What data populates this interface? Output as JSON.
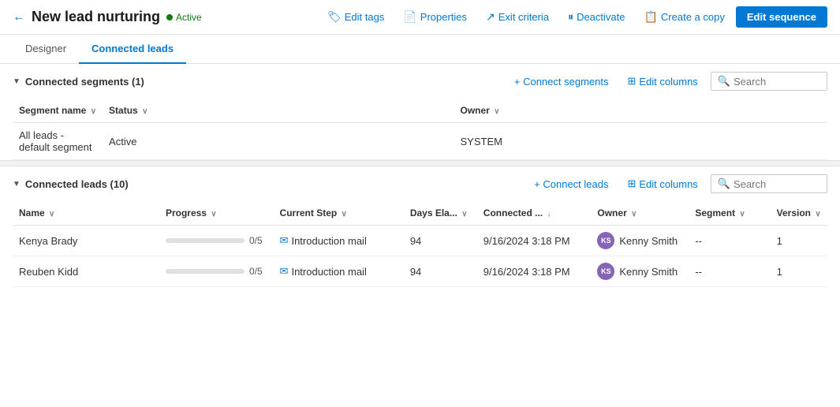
{
  "header": {
    "back_label": "←",
    "title": "New lead nurturing",
    "status": "Active",
    "actions": [
      {
        "label": "Edit tags",
        "icon": "🏷"
      },
      {
        "label": "Properties",
        "icon": "📄"
      },
      {
        "label": "Exit criteria",
        "icon": "↗"
      },
      {
        "label": "Deactivate",
        "icon": "⏸"
      },
      {
        "label": "Create a copy",
        "icon": "📋"
      }
    ],
    "edit_seq_label": "Edit sequence"
  },
  "tabs": [
    {
      "label": "Designer",
      "active": false
    },
    {
      "label": "Connected leads",
      "active": true
    }
  ],
  "segments_section": {
    "title": "Connected segments (1)",
    "connect_label": "+ Connect segments",
    "edit_columns_label": "Edit columns",
    "search_placeholder": "Search",
    "columns": [
      {
        "label": "Segment name",
        "sortable": true
      },
      {
        "label": "Status",
        "sortable": true
      },
      {
        "label": "Owner",
        "sortable": true
      }
    ],
    "rows": [
      {
        "segment_name": "All leads - default segment",
        "status": "Active",
        "owner": "SYSTEM"
      }
    ]
  },
  "leads_section": {
    "title": "Connected leads (10)",
    "connect_label": "+ Connect leads",
    "edit_columns_label": "Edit columns",
    "search_placeholder": "Search",
    "columns": [
      {
        "label": "Name",
        "sortable": true
      },
      {
        "label": "Progress",
        "sortable": true
      },
      {
        "label": "Current Step",
        "sortable": true
      },
      {
        "label": "Days Ela...",
        "sortable": true
      },
      {
        "label": "Connected ...",
        "sortable": true,
        "sort_active": true
      },
      {
        "label": "Owner",
        "sortable": true
      },
      {
        "label": "Segment",
        "sortable": true
      },
      {
        "label": "Version",
        "sortable": true
      }
    ],
    "rows": [
      {
        "name": "Kenya Brady",
        "progress": "0/5",
        "progress_pct": 0,
        "current_step": "Introduction mail",
        "days_elapsed": "94",
        "connected_date": "9/16/2024 3:18 PM",
        "owner": "Kenny Smith",
        "owner_initials": "KS",
        "segment": "--",
        "version": "1"
      },
      {
        "name": "Reuben Kidd",
        "progress": "0/5",
        "progress_pct": 0,
        "current_step": "Introduction mail",
        "days_elapsed": "94",
        "connected_date": "9/16/2024 3:18 PM",
        "owner": "Kenny Smith",
        "owner_initials": "KS",
        "segment": "--",
        "version": "1"
      }
    ]
  }
}
